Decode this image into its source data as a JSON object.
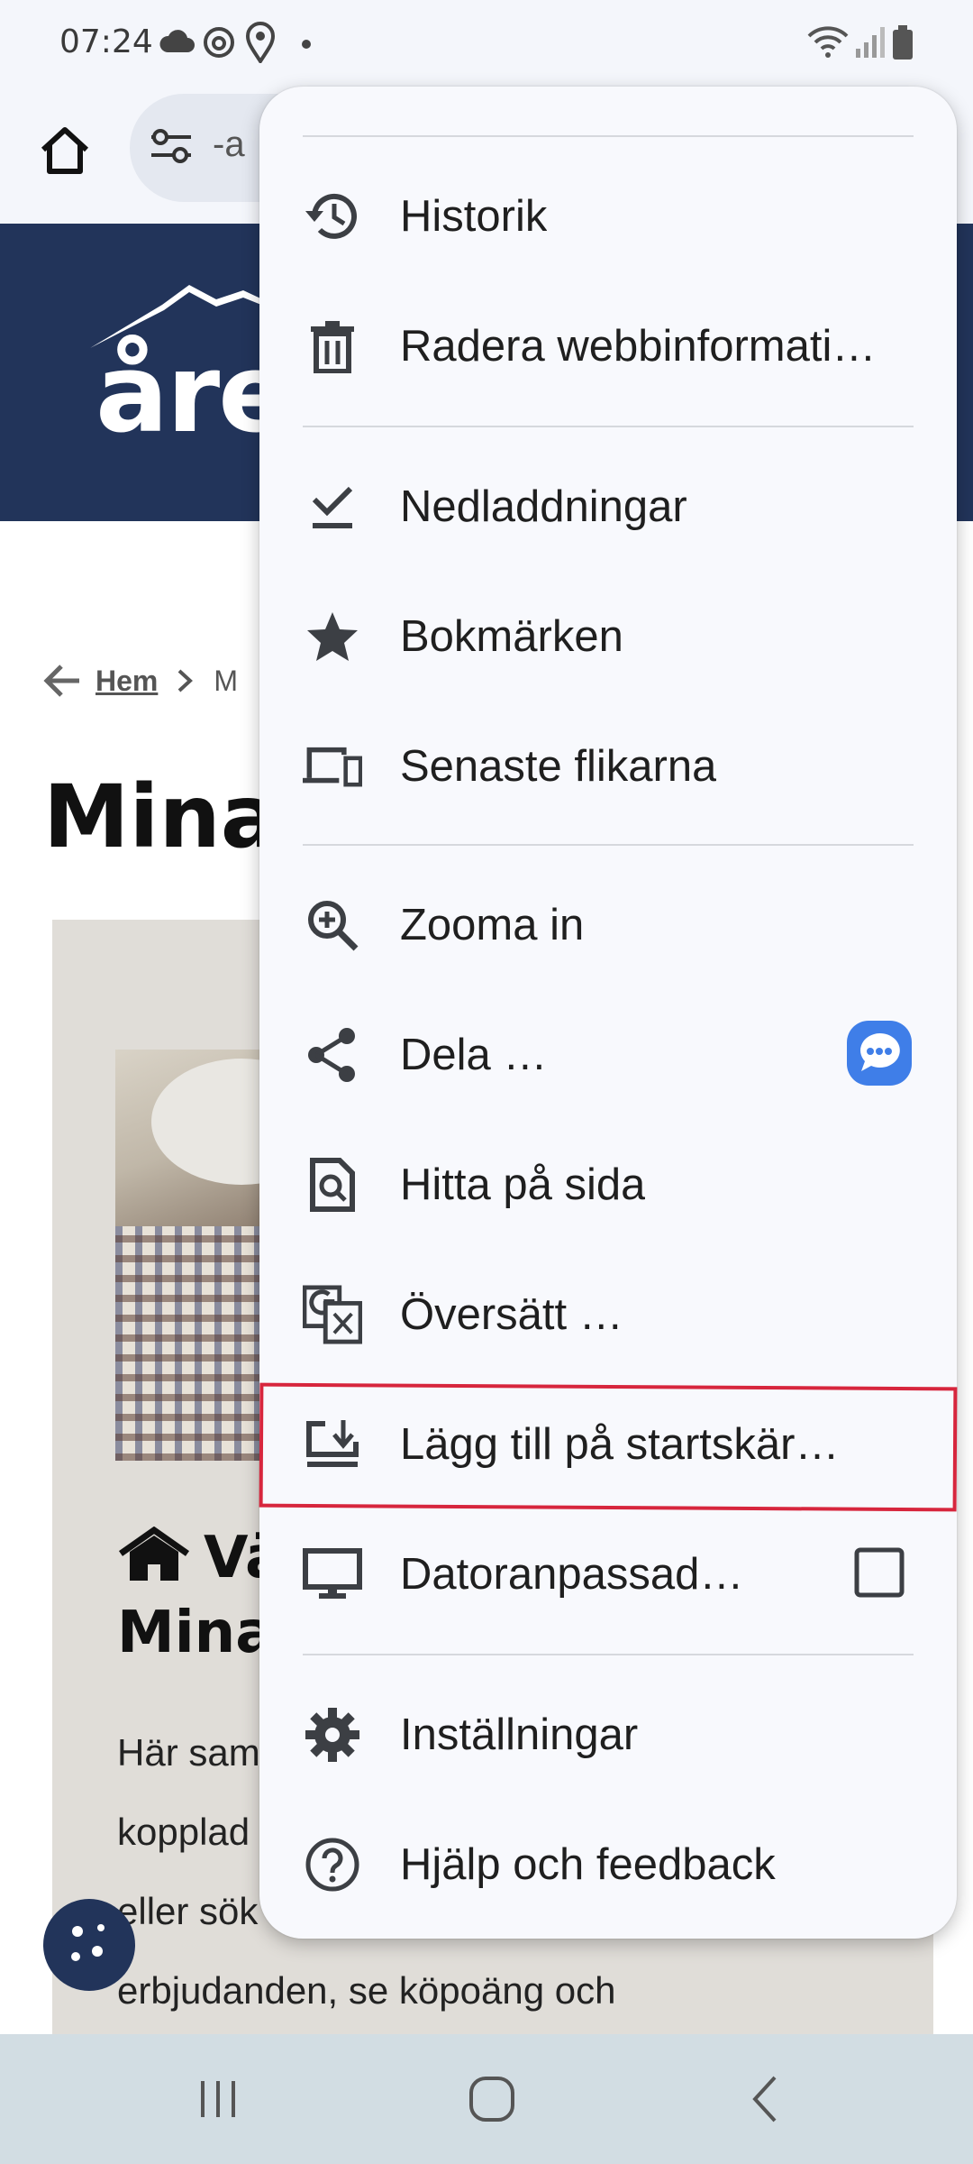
{
  "status_bar": {
    "time": "07:24",
    "icons": [
      "cloud-icon",
      "threads-icon",
      "location-pin-icon",
      "dot-icon",
      "wifi-icon",
      "signal-icon",
      "battery-icon"
    ]
  },
  "toolbar": {
    "url_fragment": "-a",
    "icons": [
      "home-icon",
      "tune-icon"
    ]
  },
  "site": {
    "logo_text": "åreh",
    "breadcrumb": {
      "home": "Hem",
      "current": "M"
    },
    "page_title": "Mina",
    "card": {
      "heading_line1": "Vä",
      "heading_line2": "Mina",
      "text_lines": [
        "Här sam",
        "kopplad",
        "eller sök",
        "erbjudanden, se köpoäng och"
      ]
    }
  },
  "menu": {
    "items": [
      {
        "label": "Historik",
        "icon": "history-icon"
      },
      {
        "label": "Radera webbinformati…",
        "icon": "trash-icon"
      },
      {
        "label": "Nedladdningar",
        "icon": "download-done-icon"
      },
      {
        "label": "Bokmärken",
        "icon": "star-icon"
      },
      {
        "label": "Senaste flikarna",
        "icon": "devices-icon"
      },
      {
        "label": "Zooma in",
        "icon": "zoom-in-icon"
      },
      {
        "label": "Dela …",
        "icon": "share-icon",
        "trailing": "messages-icon"
      },
      {
        "label": "Hitta på sida",
        "icon": "find-in-page-icon"
      },
      {
        "label": "Översätt …",
        "icon": "translate-icon"
      },
      {
        "label": "Lägg till på startskär…",
        "icon": "add-to-home-screen-icon"
      },
      {
        "label": "Datoranpassad…",
        "icon": "desktop-icon",
        "trailing": "checkbox"
      },
      {
        "label": "Inställningar",
        "icon": "settings-icon"
      },
      {
        "label": "Hjälp och feedback",
        "icon": "help-icon"
      }
    ],
    "desktop_checkbox_checked": false,
    "highlight_color": "#d7263d"
  },
  "colors": {
    "site_header": "#22345a",
    "menu_bg": "#f8f9fd",
    "navbar_bg": "#d2dde3",
    "messages_blue": "#3f7ee8"
  },
  "nav_bar": {
    "icons": [
      "recents-icon",
      "home-circle-icon",
      "back-icon"
    ]
  }
}
